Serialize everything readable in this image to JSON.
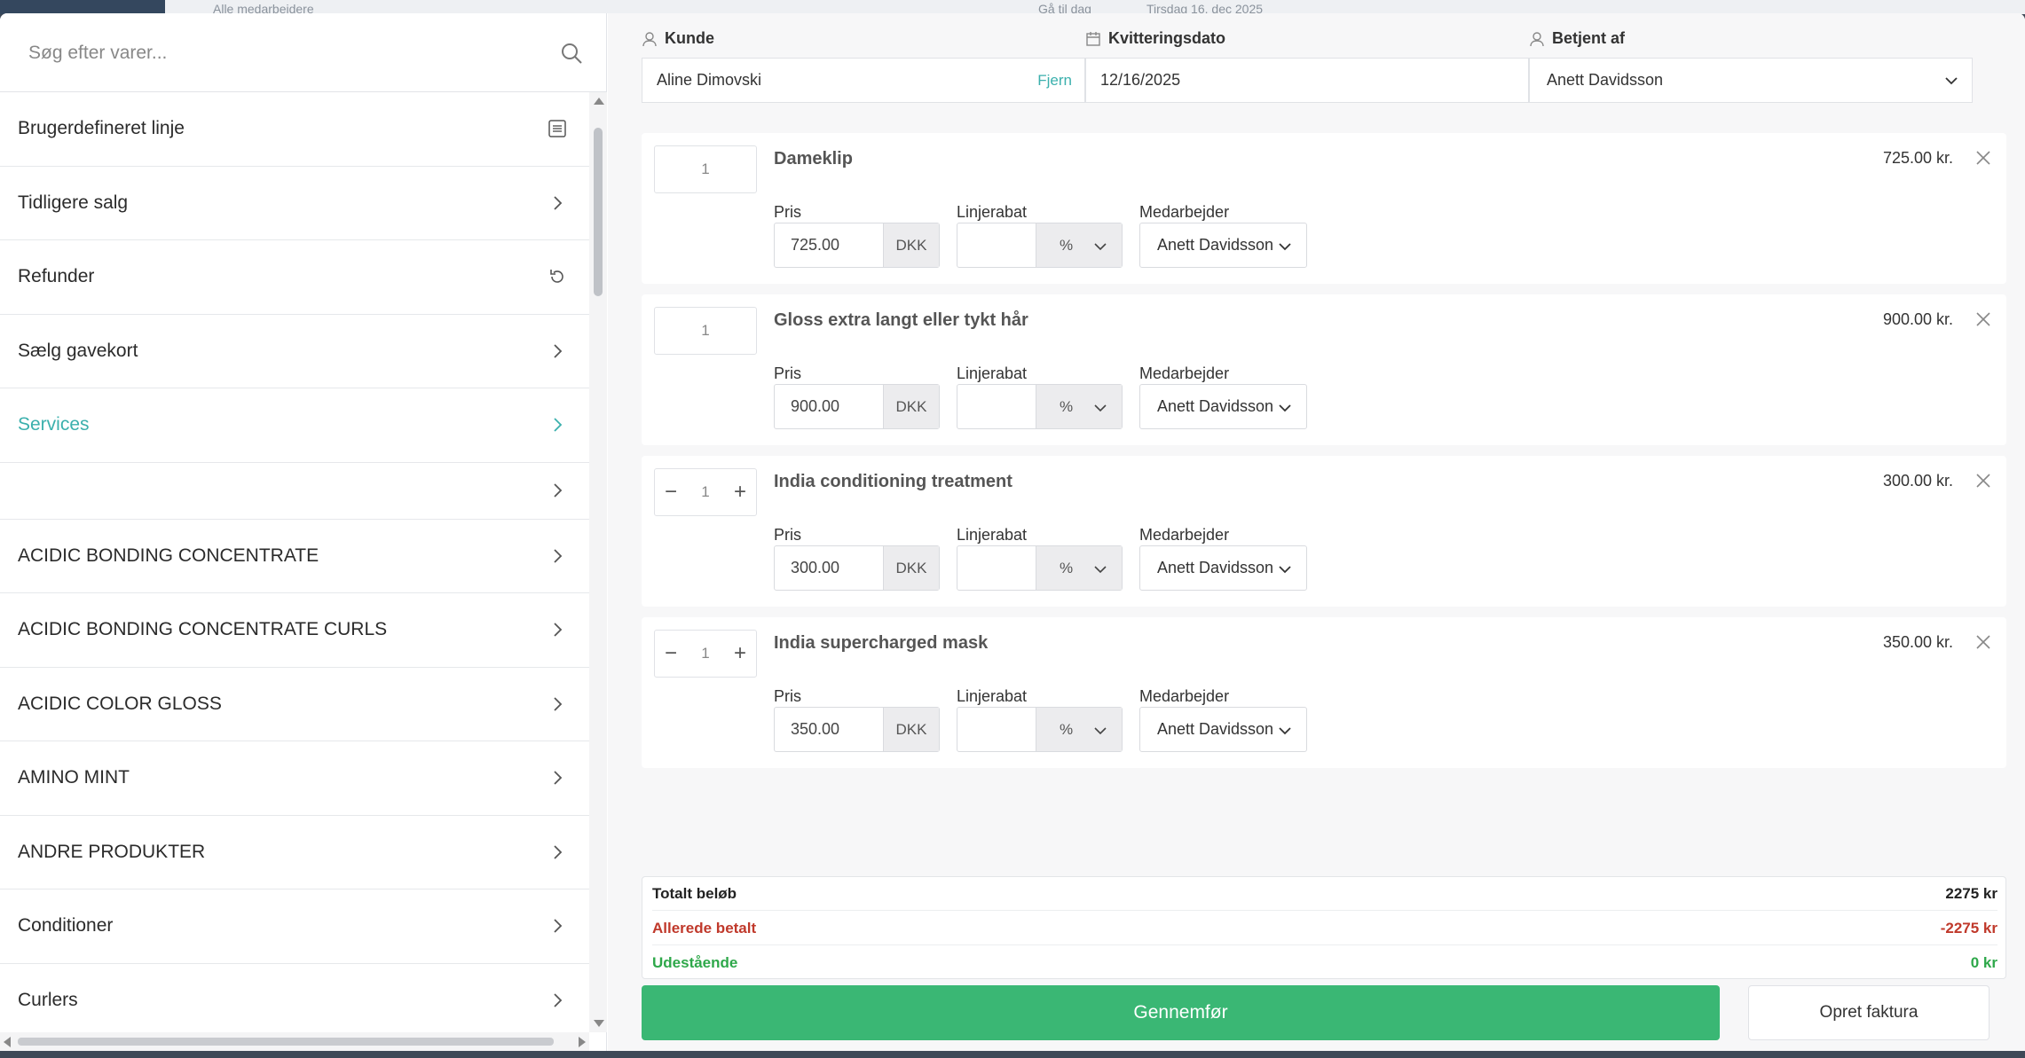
{
  "background": {
    "staff_filter": "Alle medarbejdere",
    "today_button": "Gå til dag",
    "date_label": "Tirsdag 16. dec 2025"
  },
  "search": {
    "placeholder": "Søg efter varer..."
  },
  "sidebar": {
    "items": [
      {
        "label": "Brugerdefineret linje",
        "icon": "list-icon"
      },
      {
        "label": "Tidligere salg",
        "icon": "chevron-right-icon"
      },
      {
        "label": "Refunder",
        "icon": "refresh-icon"
      },
      {
        "label": "Sælg gavekort",
        "icon": "chevron-right-icon"
      },
      {
        "label": "Services",
        "icon": "chevron-right-icon",
        "active": true
      },
      {
        "label": "",
        "icon": "chevron-right-icon"
      },
      {
        "label": "ACIDIC BONDING CONCENTRATE",
        "icon": "chevron-right-icon"
      },
      {
        "label": "ACIDIC BONDING CONCENTRATE CURLS",
        "icon": "chevron-right-icon"
      },
      {
        "label": "ACIDIC COLOR GLOSS",
        "icon": "chevron-right-icon"
      },
      {
        "label": "AMINO MINT",
        "icon": "chevron-right-icon"
      },
      {
        "label": "ANDRE PRODUKTER",
        "icon": "chevron-right-icon"
      },
      {
        "label": "Conditioner",
        "icon": "chevron-right-icon"
      },
      {
        "label": "Curlers",
        "icon": "chevron-right-icon"
      }
    ]
  },
  "header": {
    "customer_label": "Kunde",
    "customer_value": "Aline Dimovski",
    "remove_label": "Fjern",
    "date_label": "Kvitteringsdato",
    "date_value": "12/16/2025",
    "served_label": "Betjent af",
    "served_value": "Anett Davidsson"
  },
  "field_labels": {
    "price": "Pris",
    "discount": "Linjerabat",
    "employee": "Medarbejder",
    "currency": "DKK",
    "percent": "%"
  },
  "lines": [
    {
      "name": "Dameklip",
      "qty": "1",
      "price": "725.00",
      "total": "725.00 kr.",
      "employee": "Anett Davidsson",
      "stepper": false
    },
    {
      "name": "Gloss extra langt eller tykt hår",
      "qty": "1",
      "price": "900.00",
      "total": "900.00 kr.",
      "employee": "Anett Davidsson",
      "stepper": false
    },
    {
      "name": "India conditioning treatment",
      "qty": "1",
      "price": "300.00",
      "total": "300.00 kr.",
      "employee": "Anett Davidsson",
      "stepper": true
    },
    {
      "name": "India supercharged mask",
      "qty": "1",
      "price": "350.00",
      "total": "350.00 kr.",
      "employee": "Anett Davidsson",
      "stepper": true
    }
  ],
  "totals": {
    "total_label": "Totalt beløb",
    "total_value": "2275 kr",
    "paid_label": "Allerede betalt",
    "paid_value": "-2275 kr",
    "outstanding_label": "Udestående",
    "outstanding_value": "0 kr"
  },
  "actions": {
    "complete": "Gennemfør",
    "invoice": "Opret faktura"
  },
  "colors": {
    "accent": "#3bb0ad",
    "primary_button": "#3ab774",
    "danger": "#c0392b",
    "success": "#2ea84a"
  }
}
